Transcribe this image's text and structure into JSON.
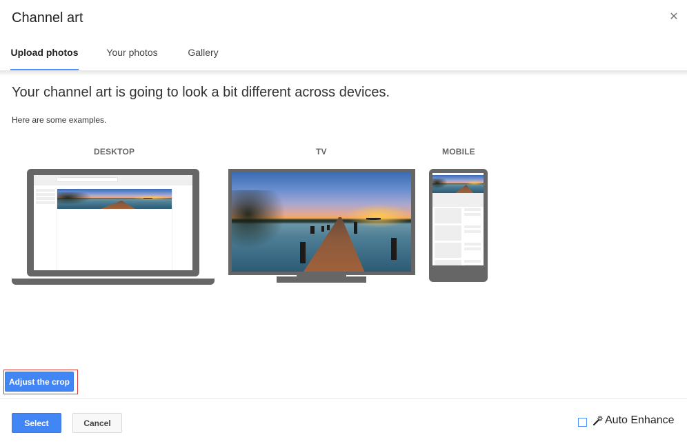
{
  "dialog": {
    "title": "Channel art",
    "close_icon": "close-icon"
  },
  "tabs": [
    {
      "label": "Upload photos",
      "active": true
    },
    {
      "label": "Your photos",
      "active": false
    },
    {
      "label": "Gallery",
      "active": false
    }
  ],
  "main": {
    "headline": "Your channel art is going to look a bit different across devices.",
    "subtext": "Here are some examples.",
    "devices": [
      {
        "label": "DESKTOP",
        "icon": "laptop-icon"
      },
      {
        "label": "TV",
        "icon": "tv-icon"
      },
      {
        "label": "MOBILE",
        "icon": "phone-icon"
      }
    ],
    "adjust_crop_label": "Adjust the crop"
  },
  "footer": {
    "select_label": "Select",
    "cancel_label": "Cancel",
    "auto_enhance_label": "Auto Enhance",
    "auto_enhance_checked": false,
    "auto_enhance_icon": "magic-wand-icon"
  },
  "colors": {
    "accent": "#4285f4",
    "tab_indicator": "#4d90fe",
    "device_frame": "#666666",
    "highlight_outline": "#e03b3b"
  }
}
